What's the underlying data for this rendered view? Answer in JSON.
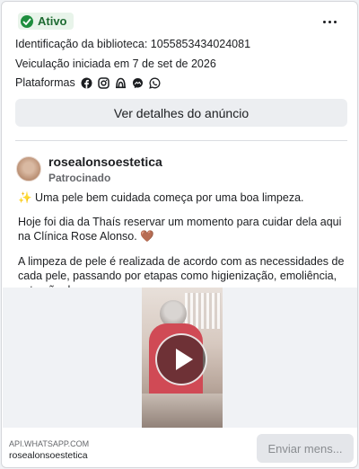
{
  "status": {
    "label": "Ativo",
    "color": "#1e8e3e"
  },
  "menu": {
    "icon": "more-horizontal-icon"
  },
  "meta": {
    "library_id": "Identificação da biblioteca: 1055853434024081",
    "started": "Veiculação iniciada em 7 de set de 2026",
    "platforms_label": "Plataformas",
    "platforms": [
      "facebook-icon",
      "instagram-icon",
      "audience-network-icon",
      "messenger-icon",
      "whatsapp-icon"
    ]
  },
  "details_button": "Ver detalhes do anúncio",
  "ad": {
    "advertiser": "rosealonsoestetica",
    "sponsored": "Patrocinado",
    "line1": "✨ Uma pele bem cuidada começa por uma boa limpeza.",
    "line2": "Hoje foi dia da Thaís reservar um momento para cuidar dela aqui na Clínica Rose Alonso. 🤎",
    "line3": "A limpeza de pele é realizada de acordo com as necessidades de cada pele, passando por etapas como higienização, emoliência, extração de cravos e…"
  },
  "footer": {
    "domain": "API.WHATSAPP.COM",
    "name": "rosealonsoestetica",
    "cta": "Enviar mens..."
  }
}
